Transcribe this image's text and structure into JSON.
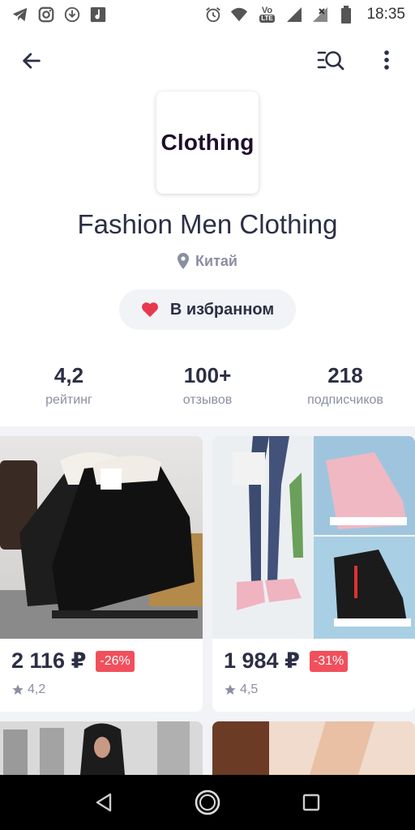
{
  "status_bar": {
    "time": "18:35",
    "left_icons": [
      "telegram-icon",
      "instagram-icon",
      "download-icon",
      "music-app-icon"
    ],
    "right_icons": [
      "alarm-icon",
      "wifi-icon",
      "volte-icon",
      "signal-icon",
      "signal-x-icon",
      "battery-icon"
    ],
    "volte_top": "Vo",
    "volte_bottom": "LTE"
  },
  "app_bar": {
    "back_icon": "arrow-left-icon",
    "search_icon": "list-search-icon",
    "more_icon": "more-vert-icon"
  },
  "shop": {
    "logo_text": "Clothing",
    "name": "Fashion Men Clothing",
    "location": "Китай",
    "favorite_label": "В избранном"
  },
  "stats": [
    {
      "value": "4,2",
      "label": "рейтинг"
    },
    {
      "value": "100+",
      "label": "отзывов"
    },
    {
      "value": "218",
      "label": "подписчиков"
    }
  ],
  "products": [
    {
      "price": "2 116 ₽",
      "discount": "-26%",
      "rating": "4,2",
      "image": "black-winter-boots"
    },
    {
      "price": "1 984 ₽",
      "discount": "-31%",
      "rating": "4,5",
      "image": "pink-and-black-sneakers"
    },
    {
      "image": "woman-fur-hood",
      "price": "",
      "discount": "",
      "rating": ""
    },
    {
      "image": "legs-product-photo",
      "price": "",
      "discount": "",
      "rating": ""
    }
  ],
  "colors": {
    "accent_red": "#f24f5c",
    "text_dark": "#2c2f45",
    "text_muted": "#8a8fa0",
    "chip_bg": "#f2f3f6",
    "heart": "#e8384f"
  }
}
